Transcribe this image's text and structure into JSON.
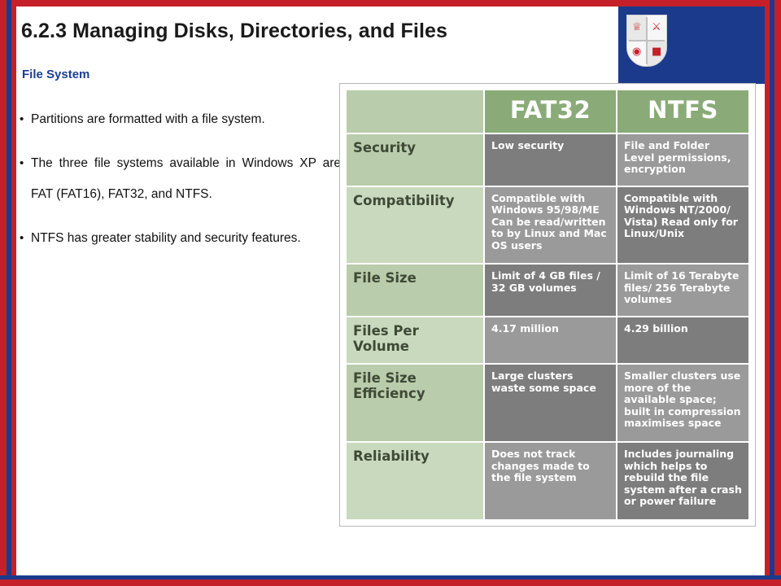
{
  "slide": {
    "title": "6.2.3 Managing Disks, Directories, and Files",
    "subhead": "File System",
    "bullets": [
      "Partitions are formatted with a file system.",
      "The three file systems available in Windows XP are FAT (FAT16), FAT32, and NTFS.",
      "NTFS has greater stability and security features."
    ]
  },
  "branding": {
    "crest_line1": "",
    "crest_icon": "university-crest-icon"
  },
  "comparison": {
    "header": {
      "blank": "",
      "col1": "FAT32",
      "col2": "NTFS"
    },
    "rows": [
      {
        "label": "Security",
        "fat32": "Low security",
        "ntfs": "File and Folder Level permissions, encryption"
      },
      {
        "label": "Compatibility",
        "fat32": "Compatible with Windows 95/98/ME Can be read/written to by Linux and Mac OS users",
        "ntfs": "Compatible with Windows NT/2000/ Vista) Read only for Linux/Unix"
      },
      {
        "label": "File Size",
        "fat32": "Limit of 4 GB files / 32 GB volumes",
        "ntfs": "Limit of 16 Terabyte files/ 256 Terabyte volumes"
      },
      {
        "label": "Files Per Volume",
        "fat32": "4.17 million",
        "ntfs": "4.29 billion"
      },
      {
        "label": "File Size Efficiency",
        "fat32": "Large clusters waste some space",
        "ntfs": "Smaller clusters use more of the available space; built in compression maximises space"
      },
      {
        "label": "Reliability",
        "fat32": "Does not track changes made to the file system",
        "ntfs": "Includes journaling which helps to rebuild the file system after a crash or power failure"
      }
    ]
  },
  "colors": {
    "frame_red": "#c5202a",
    "frame_blue": "#1b3a8c",
    "subhead_blue": "#1c3f94",
    "table_label_green": "#b9ccab",
    "table_header_green": "#8aab77",
    "table_cell_gray": "#7d7d7d"
  }
}
